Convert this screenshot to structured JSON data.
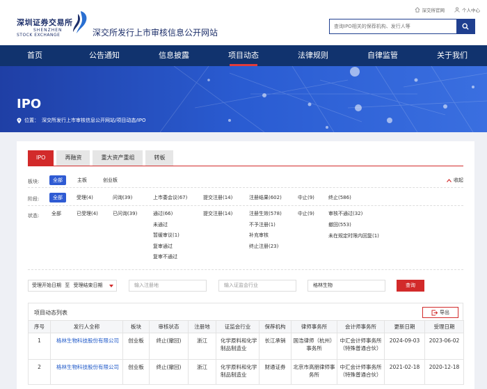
{
  "header": {
    "logo_cn": "深圳证券交易所",
    "logo_en_1": "SHENZHEN",
    "logo_en_2": "STOCK EXCHANGE",
    "site_title": "深交所发行上市审核信息公开网站",
    "link_home": "深交所官网",
    "link_user": "个人中心",
    "search_placeholder": "查询IPO相关的保荐机构、发行人等"
  },
  "nav": [
    "首页",
    "公告通知",
    "信息披露",
    "项目动态",
    "法律规则",
    "自律监管",
    "关于我们"
  ],
  "nav_active_index": 3,
  "banner": {
    "title": "IPO",
    "breadcrumb_label": "位置：",
    "breadcrumb_path": "深交所发行上市审核信息公开网站/项目动态/IPO"
  },
  "tabs": [
    "IPO",
    "再融资",
    "重大资产重组",
    "转板"
  ],
  "filters": {
    "board_label": "板块:",
    "board": [
      "全部",
      "主板",
      "创业板"
    ],
    "collapse": "收起",
    "stage_label": "阶段:",
    "stage": [
      "全部",
      "受理(4)",
      "问询(39)",
      "上市委会议(67)",
      "提交注册(14)",
      "注册结果(602)",
      "中止(9)",
      "终止(586)"
    ],
    "status_label": "状态:",
    "status_all": "全部",
    "status_accepted": "已受理(4)",
    "status_inquired": "已问询(39)",
    "status_meeting": [
      "通过(66)",
      "未通过",
      "暂缓审议(1)",
      "复审通过",
      "复审不通过"
    ],
    "status_submit": "提交注册(14)",
    "status_register": [
      "注册生效(578)",
      "不予注册(1)",
      "补充审核",
      "终止注册(23)"
    ],
    "status_suspend": "中止(9)",
    "status_terminate": [
      "审核不通过(32)",
      "撤回(553)",
      "未在规定时限内回复(1)"
    ]
  },
  "search": {
    "date_start": "受理开始日期",
    "date_sep": "至",
    "date_end": "受理结束日期",
    "region_placeholder": "输入注册地",
    "industry_placeholder": "输入证监会行业",
    "keyword_value": "格林生物",
    "query_label": "查询"
  },
  "results": {
    "title": "项目动态列表",
    "export_label": "导出",
    "columns": [
      "序号",
      "发行人全称",
      "板块",
      "审核状态",
      "注册地",
      "证监会行业",
      "保荐机构",
      "律师事务所",
      "会计师事务所",
      "更新日期",
      "受理日期"
    ],
    "rows": [
      [
        "1",
        "格林生物科技股份有限公司",
        "创业板",
        "终止(撤回)",
        "浙江",
        "化学原料和化学制品制造业",
        "长江承销",
        "国浩律师（杭州）事务所",
        "中汇会计师事务所（特殊普通合伙）",
        "2024-09-03",
        "2023-06-02"
      ],
      [
        "2",
        "格林生物科技股份有限公司",
        "创业板",
        "终止(撤回)",
        "浙江",
        "化学原料和化学制品制造业",
        "财通证券",
        "北京市高朋律师事务所",
        "中汇会计师事务所（特殊普通合伙）",
        "2021-02-18",
        "2020-12-18"
      ]
    ]
  },
  "colors": {
    "nav_bg": "#11336e",
    "accent_red": "#d22a2a",
    "selected_blue": "#2f5bd3",
    "link_blue": "#1e58c8"
  }
}
